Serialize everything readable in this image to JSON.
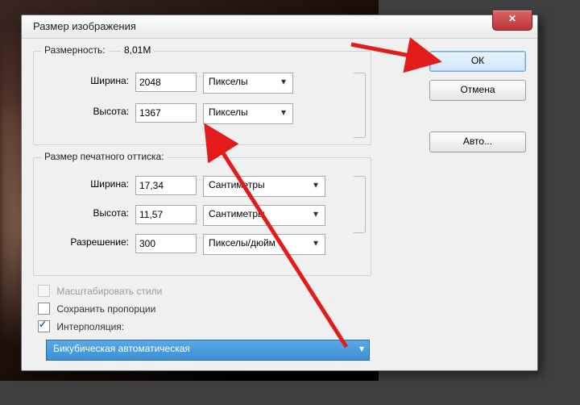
{
  "dialog": {
    "title": "Размер изображения",
    "close_glyph": "✕"
  },
  "dims_group": {
    "caption": "Размерность:",
    "size_value": "8,01M",
    "width_label": "Ширина:",
    "width_value": "2048",
    "height_label": "Высота:",
    "height_value": "1367",
    "unit_w": "Пикселы",
    "unit_h": "Пикселы"
  },
  "print_group": {
    "caption": "Размер печатного оттиска:",
    "width_label": "Ширина:",
    "width_value": "17,34",
    "height_label": "Высота:",
    "height_value": "11,57",
    "res_label": "Разрешение:",
    "res_value": "300",
    "unit_w": "Сантиметры",
    "unit_h": "Сантиметры",
    "unit_res": "Пикселы/дюйм"
  },
  "checks": {
    "scale_styles": "Масштабировать стили",
    "constrain": "Сохранить пропорции",
    "resample": "Интерполяция:"
  },
  "resample_method": "Бикубическая автоматическая",
  "buttons": {
    "ok": "ОК",
    "cancel": "Отмена",
    "auto": "Авто..."
  }
}
